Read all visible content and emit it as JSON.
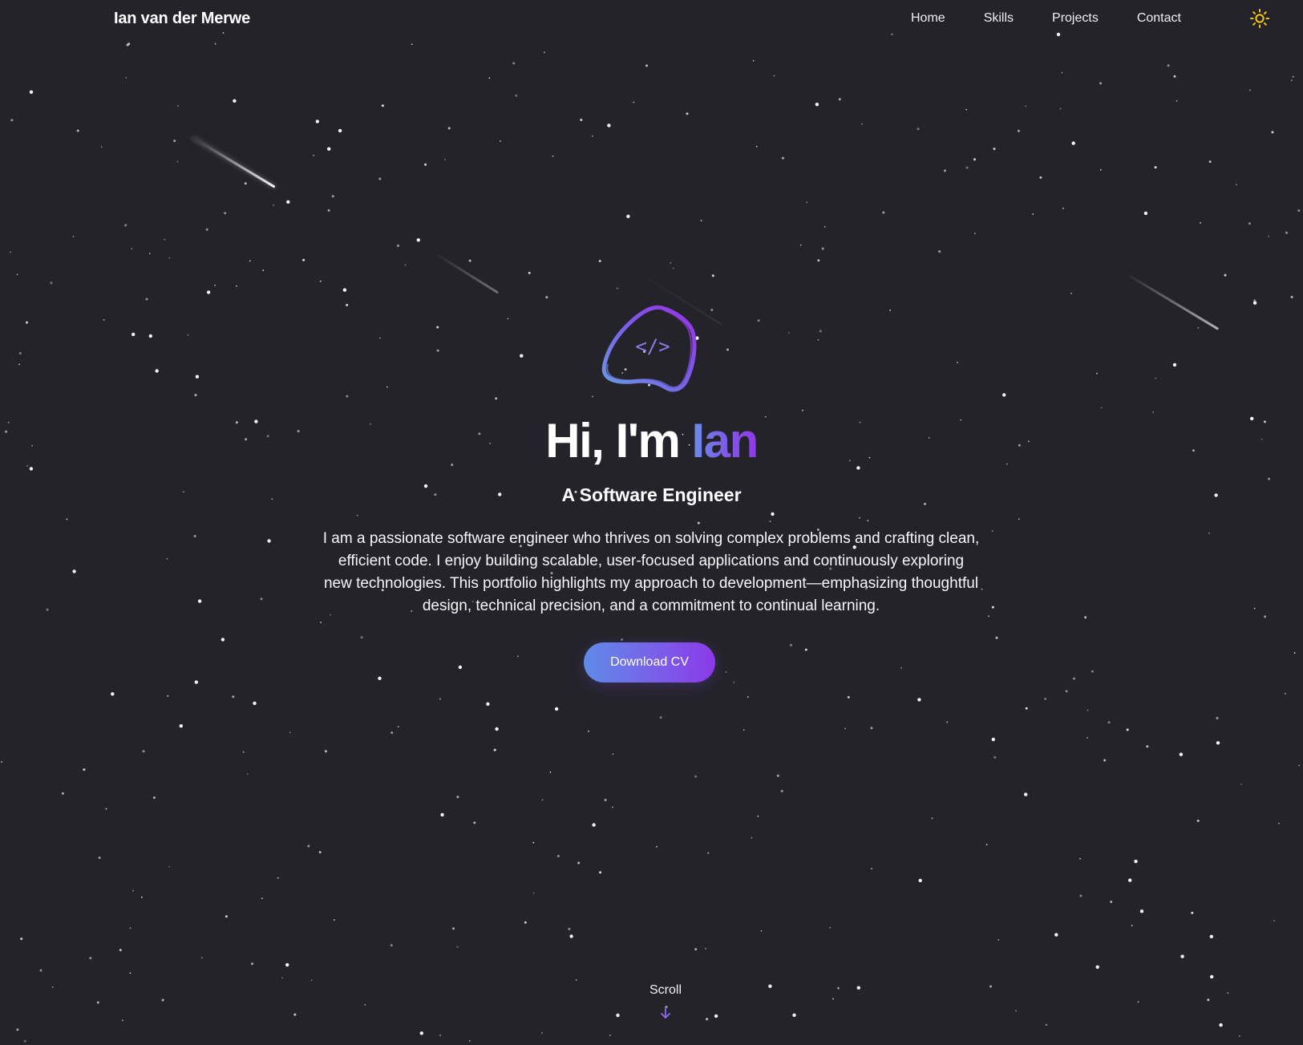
{
  "nav": {
    "brand": "Ian van der Merwe",
    "links": [
      "Home",
      "Skills",
      "Projects",
      "Contact"
    ],
    "theme_icon": "sun-icon"
  },
  "hero": {
    "logo_icon": "code-blob-icon",
    "logo_text": "</>",
    "greeting": "Hi, I'm ",
    "name": "Ian",
    "subtitle": "A Software Engineer",
    "bio": "I am a passionate software engineer who thrives on solving complex problems and crafting clean, efficient code. I enjoy building scalable, user-focused applications and continuously exploring new technologies. This portfolio highlights my approach to development—emphasizing thoughtful design, technical precision, and a commitment to continual learning.",
    "cta_label": "Download CV"
  },
  "scroll": {
    "label": "Scroll",
    "icon": "arrow-down-icon"
  },
  "colors": {
    "background": "#25232a",
    "accent_start": "#5f8be6",
    "accent_mid": "#7a5fe9",
    "accent_end": "#8b39e8",
    "sun": "#f5c518",
    "text": "#ffffff"
  }
}
